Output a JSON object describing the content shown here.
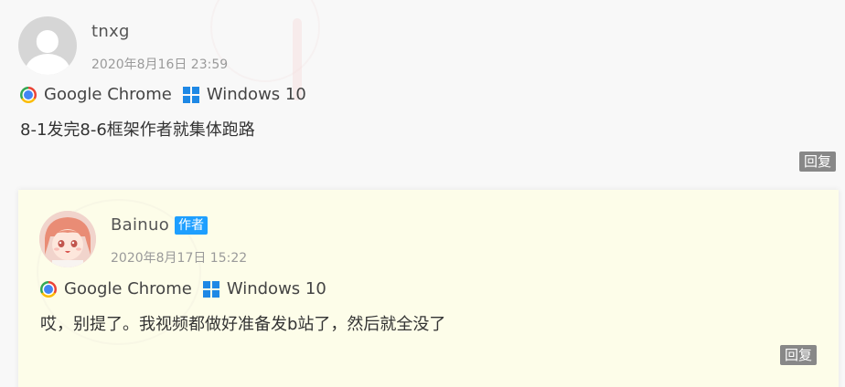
{
  "comments": [
    {
      "author": "tnxg",
      "date": "2020年8月16日 23:59",
      "browser": "Google Chrome",
      "os": "Windows 10",
      "text": "8-1发完8-6框架作者就集体跑路",
      "reply_label": "回复",
      "avatar_icon": "default-user-avatar"
    },
    {
      "author": "Bainuo",
      "badge": "作者",
      "date": "2020年8月17日 15:22",
      "browser": "Google Chrome",
      "os": "Windows 10",
      "text": "哎，别提了。我视频都做好准备发b站了，然后就全没了",
      "reply_label": "回复",
      "avatar_icon": "anime-girl-avatar"
    }
  ],
  "colors": {
    "badge": "#1e9fff",
    "reply_button": "#888888",
    "child_background": "#fdfde9"
  }
}
